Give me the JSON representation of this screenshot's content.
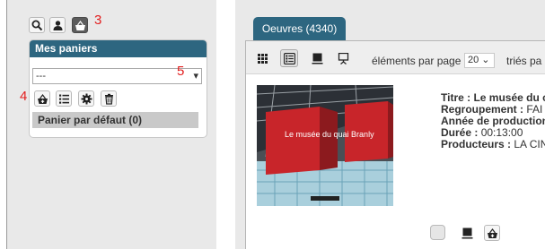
{
  "annotations": {
    "n3": "3",
    "n4": "4",
    "n5": "5"
  },
  "left_toolbar": [
    {
      "name": "search-icon",
      "active": false
    },
    {
      "name": "user-icon",
      "active": false
    },
    {
      "name": "basket-icon",
      "active": true
    }
  ],
  "baskets_panel": {
    "title": "Mes paniers",
    "select_value": "---",
    "select_arrow": "▾",
    "default_basket": "Panier par défaut (0)",
    "actions": [
      "add-basket-icon",
      "list-icon",
      "settings-icon",
      "trash-icon"
    ]
  },
  "results": {
    "tab_label": "Oeuvres (4340)",
    "view_modes": [
      "grid-view-icon",
      "list-view-icon",
      "card-view-icon",
      "presentation-icon"
    ],
    "per_page_label": "éléments par page",
    "per_page_value": "20 ⌄",
    "sort_label": "triés pa"
  },
  "item": {
    "thumbnail_caption": "Le musée du quai Branly",
    "fields": [
      {
        "label": "Titre :",
        "value": "Le musée du c",
        "bold": true
      },
      {
        "label": "Regroupement :",
        "value": "FAI"
      },
      {
        "label": "Année de production",
        "value": ""
      },
      {
        "label": "Durée :",
        "value": "00:13:00"
      },
      {
        "label": "Producteurs :",
        "value": "LA CIN"
      }
    ],
    "actions": [
      "checkbox",
      "card-icon",
      "add-to-basket-icon"
    ]
  },
  "colors": {
    "accent": "#2d6680",
    "annotation": "#e21d1d",
    "panel_bg": "#e9e9e9"
  }
}
